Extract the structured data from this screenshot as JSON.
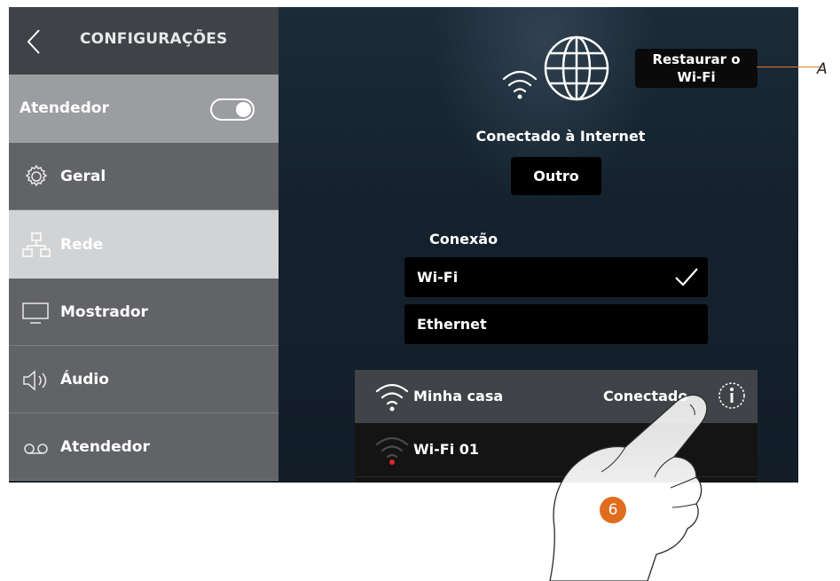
{
  "sidebar": {
    "title": "CONFIGURAÇÕES",
    "answering_toggle": {
      "label": "Atendedor",
      "state": "on"
    },
    "items": [
      {
        "label": "Geral",
        "icon": "gear-icon",
        "selected": false
      },
      {
        "label": "Rede",
        "icon": "network-icon",
        "selected": true
      },
      {
        "label": "Mostrador",
        "icon": "monitor-icon",
        "selected": false
      },
      {
        "label": "Áudio",
        "icon": "speaker-icon",
        "selected": false
      },
      {
        "label": "Atendedor",
        "icon": "voicemail-icon",
        "selected": false
      }
    ]
  },
  "main": {
    "restore_button": {
      "line1": "Restaurar o",
      "line2": "Wi-Fi"
    },
    "status": "Conectado à Internet",
    "other_button": "Outro",
    "connection_label": "Conexão",
    "connection_options": [
      {
        "label": "Wi-Fi",
        "selected": true
      },
      {
        "label": "Ethernet",
        "selected": false
      }
    ],
    "networks": [
      {
        "name": "Minha casa",
        "state": "Conectado",
        "icon": "wifi-icon"
      },
      {
        "name": "Wi-Fi 01",
        "state": "",
        "icon": "wifi-locked-icon"
      }
    ]
  },
  "annotations": {
    "callout": "A",
    "step": "6"
  },
  "colors": {
    "accent_orange": "#e06d1e",
    "sidebar_selected": "#d2d3d4",
    "sidebar_row": "#616366",
    "toggle_row": "#9b9da0"
  }
}
